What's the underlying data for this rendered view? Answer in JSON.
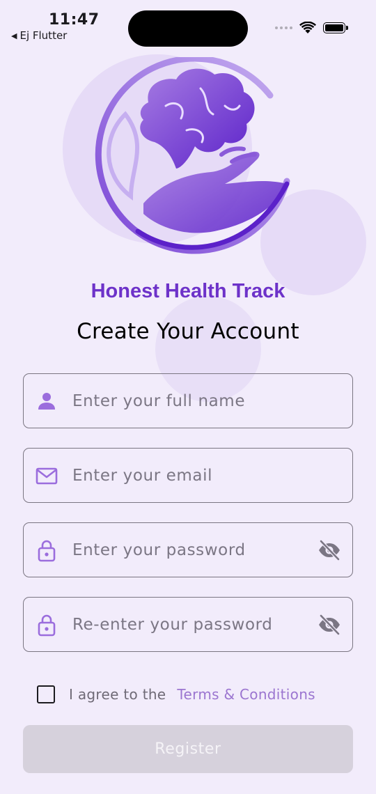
{
  "status_bar": {
    "time": "11:47",
    "back_app": "Ej Flutter"
  },
  "app": {
    "name": "Honest Health Track",
    "accent": "#6d32c9"
  },
  "form": {
    "title": "Create Your Account",
    "fields": [
      {
        "icon": "person-icon",
        "placeholder": "Enter your full name",
        "value": ""
      },
      {
        "icon": "mail-icon",
        "placeholder": "Enter your email",
        "value": ""
      },
      {
        "icon": "lock-icon",
        "placeholder": "Enter your password",
        "value": "",
        "trailing_icon": "visibility-off-icon"
      },
      {
        "icon": "lock-icon",
        "placeholder": "Re-enter your password",
        "value": "",
        "trailing_icon": "visibility-off-icon"
      }
    ],
    "terms": {
      "checked": false,
      "text": "I agree to the",
      "link": "Terms & Conditions"
    },
    "submit_label": "Register"
  }
}
